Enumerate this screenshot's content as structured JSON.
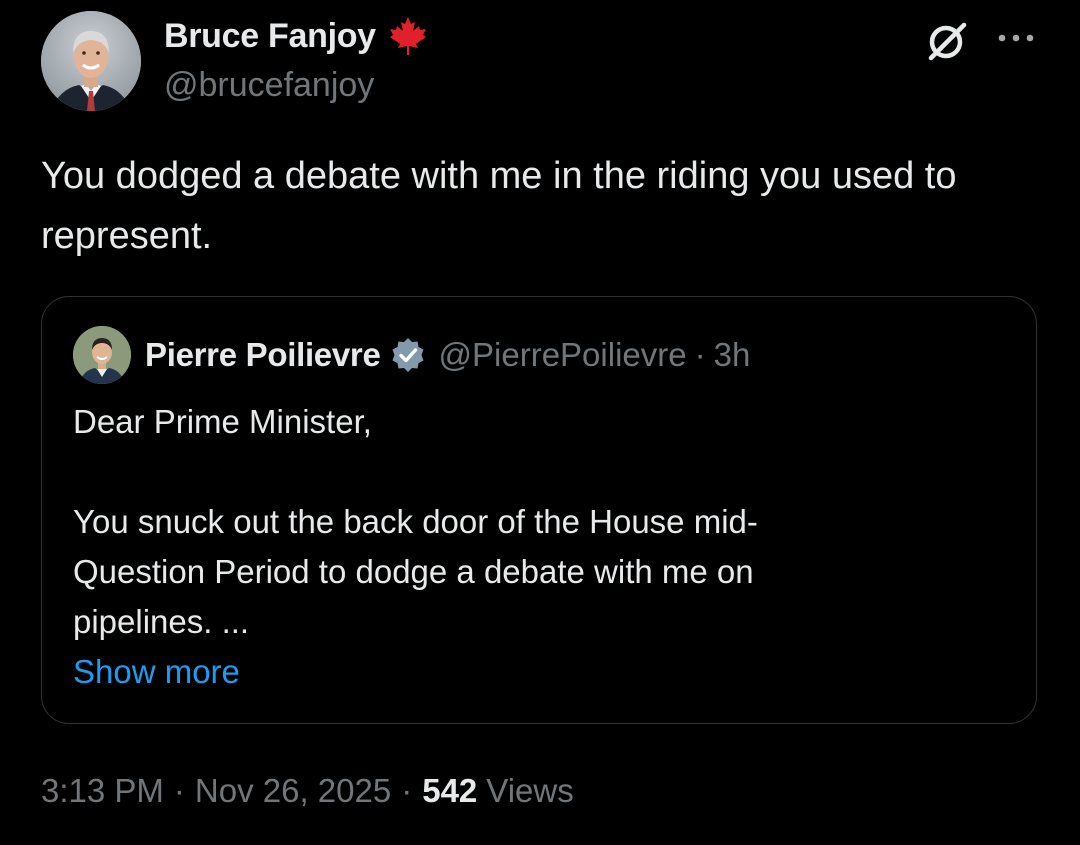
{
  "author": {
    "display_name": "Bruce Fanjoy",
    "handle": "@brucefanjoy",
    "name_badge_icon": "maple-leaf-icon"
  },
  "header_actions": {
    "grok_icon": "grok-icon",
    "more_icon": "more-icon"
  },
  "tweet": {
    "text": "You dodged a debate with me in the riding you used to represent."
  },
  "quoted_tweet": {
    "display_name": "Pierre Poilievre",
    "verified_icon": "verified-badge-icon",
    "handle": "@PierrePoilievre",
    "separator": "·",
    "time": "3h",
    "lines": [
      "Dear Prime Minister,",
      "",
      "You snuck out the back door of the House mid-",
      "Question Period to dodge a debate with me on",
      "pipelines. ..."
    ],
    "show_more_label": "Show more"
  },
  "meta": {
    "time": "3:13 PM",
    "separator": "·",
    "date": "Nov 26, 2025",
    "views_count": "542",
    "views_label": "Views"
  },
  "colors": {
    "background": "#000000",
    "primary_text": "#e7e9ea",
    "secondary_text": "#71767b",
    "link": "#1d9bf0",
    "border": "#2f3336",
    "maple_red": "#e0202b",
    "verified_blue": "#829aab"
  }
}
